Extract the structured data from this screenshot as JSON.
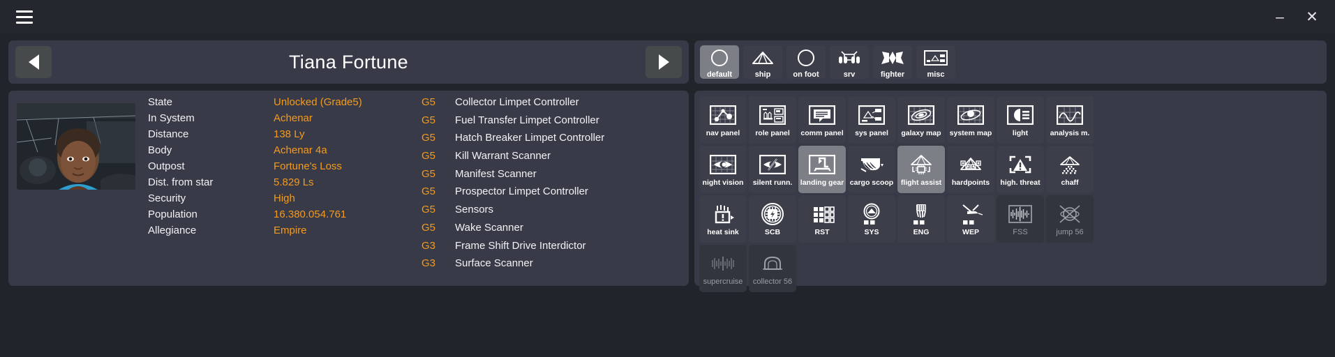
{
  "window": {
    "menu_icon": "hamburger-icon",
    "minimize_label": "–",
    "close_label": "✕"
  },
  "engineer": {
    "name": "Tiana Fortune",
    "prev_label": "◀",
    "next_label": "▶",
    "portrait_alt": "engineer-portrait",
    "details": [
      {
        "key": "State",
        "value": "Unlocked (Grade5)"
      },
      {
        "key": "In System",
        "value": "Achenar"
      },
      {
        "key": "Distance",
        "value": "138 Ly"
      },
      {
        "key": "Body",
        "value": "Achenar 4a"
      },
      {
        "key": "Outpost",
        "value": "Fortune's Loss"
      },
      {
        "key": "Dist. from star",
        "value": "5.829 Ls"
      },
      {
        "key": "Security",
        "value": "High"
      },
      {
        "key": "Population",
        "value": "16.380.054.761"
      },
      {
        "key": "Allegiance",
        "value": "Empire"
      }
    ],
    "modules": [
      {
        "grade": "G5",
        "name": "Collector Limpet Controller"
      },
      {
        "grade": "G5",
        "name": "Fuel Transfer Limpet Controller"
      },
      {
        "grade": "G5",
        "name": "Hatch Breaker Limpet Controller"
      },
      {
        "grade": "G5",
        "name": "Kill Warrant Scanner"
      },
      {
        "grade": "G5",
        "name": "Manifest Scanner"
      },
      {
        "grade": "G5",
        "name": "Prospector Limpet Controller"
      },
      {
        "grade": "G5",
        "name": "Sensors"
      },
      {
        "grade": "G5",
        "name": "Wake Scanner"
      },
      {
        "grade": "G3",
        "name": "Frame Shift Drive Interdictor"
      },
      {
        "grade": "G3",
        "name": "Surface Scanner"
      }
    ]
  },
  "modes": [
    {
      "label": "default",
      "icon": "circle-icon",
      "active": true
    },
    {
      "label": "ship",
      "icon": "ship-icon",
      "active": false
    },
    {
      "label": "on foot",
      "icon": "circle-icon",
      "active": false
    },
    {
      "label": "srv",
      "icon": "srv-icon",
      "active": false
    },
    {
      "label": "fighter",
      "icon": "fighter-icon",
      "active": false
    },
    {
      "label": "misc",
      "icon": "misc-panel-icon",
      "active": false
    }
  ],
  "tiles": [
    {
      "label": "nav panel",
      "icon": "nav-panel-icon",
      "state": "normal"
    },
    {
      "label": "role panel",
      "icon": "role-panel-icon",
      "state": "normal"
    },
    {
      "label": "comm panel",
      "icon": "comm-panel-icon",
      "state": "normal"
    },
    {
      "label": "sys panel",
      "icon": "sys-panel-icon",
      "state": "normal"
    },
    {
      "label": "galaxy map",
      "icon": "galaxy-map-icon",
      "state": "normal"
    },
    {
      "label": "system map",
      "icon": "system-map-icon",
      "state": "normal"
    },
    {
      "label": "light",
      "icon": "headlight-icon",
      "state": "normal"
    },
    {
      "label": "analysis m.",
      "icon": "analysis-mode-icon",
      "state": "normal"
    },
    {
      "label": "night vision",
      "icon": "night-vision-icon",
      "state": "normal"
    },
    {
      "label": "silent runn.",
      "icon": "silent-running-icon",
      "state": "normal"
    },
    {
      "label": "landing gear",
      "icon": "landing-gear-icon",
      "state": "active"
    },
    {
      "label": "cargo scoop",
      "icon": "cargo-scoop-icon",
      "state": "normal"
    },
    {
      "label": "flight assist",
      "icon": "flight-assist-icon",
      "state": "active"
    },
    {
      "label": "hardpoints",
      "icon": "hardpoints-icon",
      "state": "normal"
    },
    {
      "label": "high. threat",
      "icon": "high-threat-icon",
      "state": "normal"
    },
    {
      "label": "chaff",
      "icon": "chaff-icon",
      "state": "normal"
    },
    {
      "label": "heat sink",
      "icon": "heat-sink-icon",
      "state": "normal"
    },
    {
      "label": "SCB",
      "icon": "shield-cell-bank-icon",
      "state": "normal"
    },
    {
      "label": "RST",
      "icon": "reset-pips-icon",
      "state": "normal"
    },
    {
      "label": "SYS",
      "icon": "sys-pips-icon",
      "state": "normal"
    },
    {
      "label": "ENG",
      "icon": "eng-pips-icon",
      "state": "normal"
    },
    {
      "label": "WEP",
      "icon": "wep-pips-icon",
      "state": "normal"
    },
    {
      "label": "FSS",
      "icon": "fss-icon",
      "state": "dim"
    },
    {
      "label": "jump 56",
      "icon": "jump-icon",
      "state": "dim"
    },
    {
      "label": "supercruise",
      "icon": "supercruise-icon",
      "state": "dim"
    },
    {
      "label": "collector 56",
      "icon": "collector-icon",
      "state": "dim"
    }
  ],
  "colors": {
    "accent_orange": "#f59a1e",
    "panel_bg": "#383b47",
    "tile_bg": "#3c3f4a",
    "tile_active": "#7c7f86",
    "window_bg": "#22242c",
    "titlebar_bg": "#25272f"
  }
}
